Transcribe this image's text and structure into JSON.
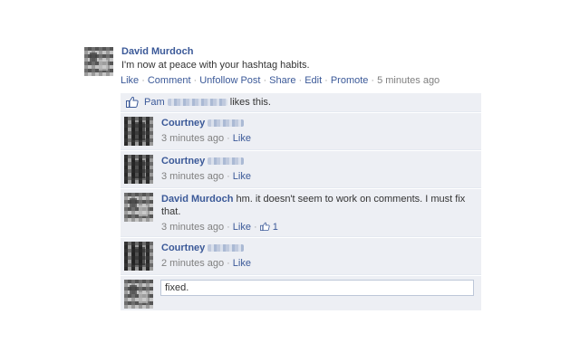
{
  "post": {
    "author": "David Murdoch",
    "text": "I'm now at peace with your hashtag habits.",
    "actions": {
      "like": "Like",
      "comment": "Comment",
      "unfollow": "Unfollow Post",
      "share": "Share",
      "edit": "Edit",
      "promote": "Promote",
      "time": "5 minutes ago"
    }
  },
  "likes": {
    "name": "Pam",
    "suffix": "likes this."
  },
  "comments": [
    {
      "author": "Courtney",
      "time": "3 minutes ago",
      "like": "Like"
    },
    {
      "author": "Courtney",
      "time": "3 minutes ago",
      "like": "Like"
    },
    {
      "author": "David Murdoch",
      "text": "hm. it doesn't seem to work on comments. I must fix that.",
      "time": "3 minutes ago",
      "like": "Like",
      "like_count": "1"
    },
    {
      "author": "Courtney",
      "time": "2 minutes ago",
      "like": "Like"
    }
  ],
  "reply": {
    "value": "fixed."
  },
  "icons": {
    "like": "thumbs-up-icon",
    "avatar": "pixelated-avatar"
  },
  "colors": {
    "link": "#3b5998",
    "ufi_bg": "#edeff4",
    "muted": "#808080"
  }
}
